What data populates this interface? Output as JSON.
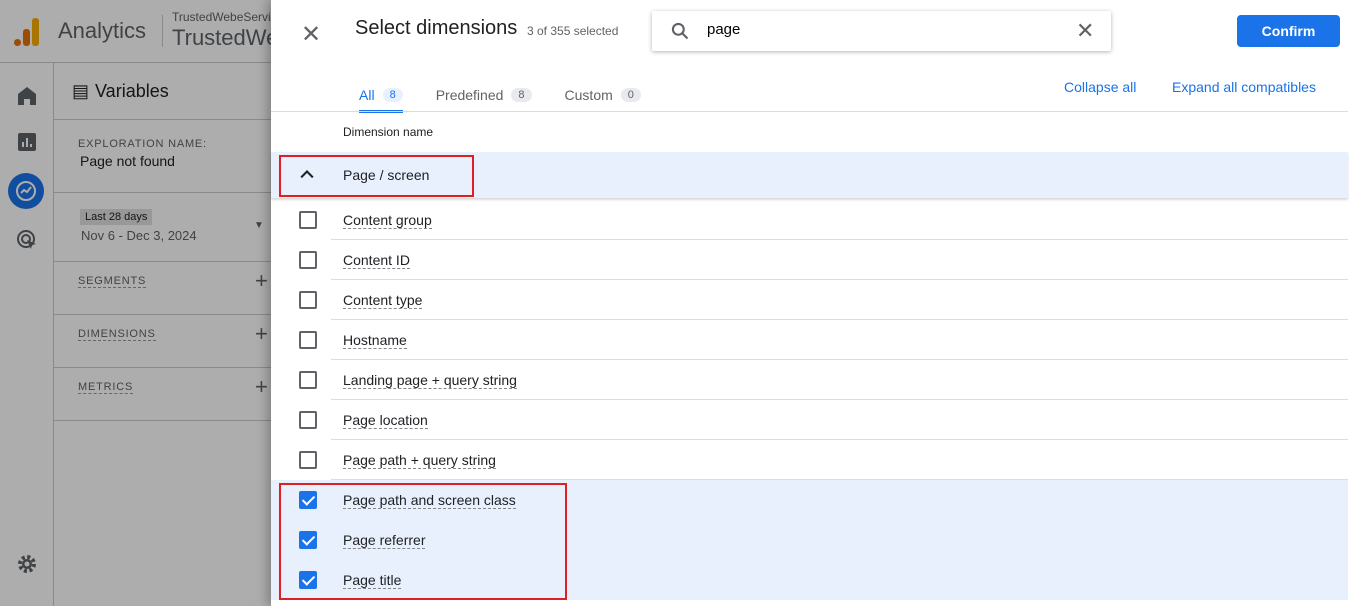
{
  "app": {
    "name": "Analytics",
    "account_line1": "TrustedWebeServices",
    "account_line2": "TrustedWebeServices"
  },
  "rail": {
    "icons": [
      "home-icon",
      "reports-icon",
      "explore-icon",
      "advertising-icon",
      "settings-icon"
    ]
  },
  "variables": {
    "title": "Variables",
    "exploration_label": "EXPLORATION NAME:",
    "exploration_name": "Page not found",
    "date_chip": "Last 28 days",
    "date_range": "Nov 6 - Dec 3, 2024",
    "segments": "SEGMENTS",
    "dimensions": "DIMENSIONS",
    "metrics": "METRICS"
  },
  "dialog": {
    "title": "Select dimensions",
    "count": "3 of 355 selected",
    "search_value": "page",
    "confirm": "Confirm",
    "tabs": [
      {
        "label": "All",
        "count": "8"
      },
      {
        "label": "Predefined",
        "count": "8"
      },
      {
        "label": "Custom",
        "count": "0"
      }
    ],
    "collapse_all": "Collapse all",
    "expand_all": "Expand all compatibles",
    "column_header": "Dimension name",
    "group": "Page / screen",
    "items": [
      {
        "label": "Content group",
        "checked": false
      },
      {
        "label": "Content ID",
        "checked": false
      },
      {
        "label": "Content type",
        "checked": false
      },
      {
        "label": "Hostname",
        "checked": false
      },
      {
        "label": "Landing page + query string",
        "checked": false
      },
      {
        "label": "Page location",
        "checked": false
      },
      {
        "label": "Page path + query string",
        "checked": false
      },
      {
        "label": "Page path and screen class",
        "checked": true
      },
      {
        "label": "Page referrer",
        "checked": true
      },
      {
        "label": "Page title",
        "checked": true
      }
    ]
  },
  "colors": {
    "accent": "#1a73e8",
    "selected_row": "#e8f0fe",
    "highlight_box": "#e02020"
  }
}
